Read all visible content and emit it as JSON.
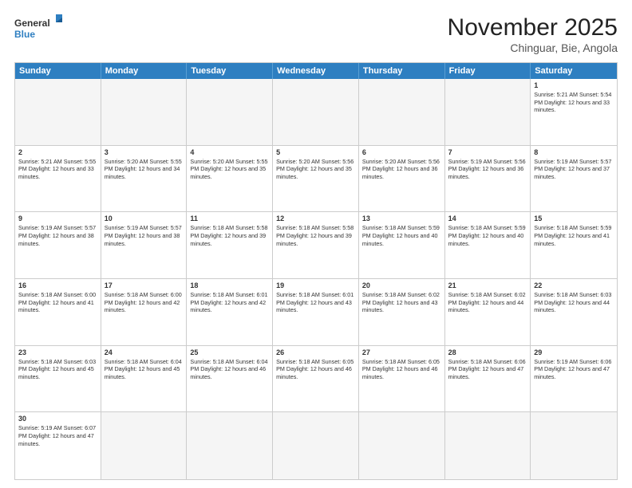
{
  "header": {
    "logo_general": "General",
    "logo_blue": "Blue",
    "month_title": "November 2025",
    "location": "Chinguar, Bie, Angola"
  },
  "weekdays": [
    "Sunday",
    "Monday",
    "Tuesday",
    "Wednesday",
    "Thursday",
    "Friday",
    "Saturday"
  ],
  "rows": [
    [
      {
        "day": "",
        "info": ""
      },
      {
        "day": "",
        "info": ""
      },
      {
        "day": "",
        "info": ""
      },
      {
        "day": "",
        "info": ""
      },
      {
        "day": "",
        "info": ""
      },
      {
        "day": "",
        "info": ""
      },
      {
        "day": "1",
        "info": "Sunrise: 5:21 AM\nSunset: 5:54 PM\nDaylight: 12 hours\nand 33 minutes."
      }
    ],
    [
      {
        "day": "2",
        "info": "Sunrise: 5:21 AM\nSunset: 5:55 PM\nDaylight: 12 hours\nand 33 minutes."
      },
      {
        "day": "3",
        "info": "Sunrise: 5:20 AM\nSunset: 5:55 PM\nDaylight: 12 hours\nand 34 minutes."
      },
      {
        "day": "4",
        "info": "Sunrise: 5:20 AM\nSunset: 5:55 PM\nDaylight: 12 hours\nand 35 minutes."
      },
      {
        "day": "5",
        "info": "Sunrise: 5:20 AM\nSunset: 5:56 PM\nDaylight: 12 hours\nand 35 minutes."
      },
      {
        "day": "6",
        "info": "Sunrise: 5:20 AM\nSunset: 5:56 PM\nDaylight: 12 hours\nand 36 minutes."
      },
      {
        "day": "7",
        "info": "Sunrise: 5:19 AM\nSunset: 5:56 PM\nDaylight: 12 hours\nand 36 minutes."
      },
      {
        "day": "8",
        "info": "Sunrise: 5:19 AM\nSunset: 5:57 PM\nDaylight: 12 hours\nand 37 minutes."
      }
    ],
    [
      {
        "day": "9",
        "info": "Sunrise: 5:19 AM\nSunset: 5:57 PM\nDaylight: 12 hours\nand 38 minutes."
      },
      {
        "day": "10",
        "info": "Sunrise: 5:19 AM\nSunset: 5:57 PM\nDaylight: 12 hours\nand 38 minutes."
      },
      {
        "day": "11",
        "info": "Sunrise: 5:18 AM\nSunset: 5:58 PM\nDaylight: 12 hours\nand 39 minutes."
      },
      {
        "day": "12",
        "info": "Sunrise: 5:18 AM\nSunset: 5:58 PM\nDaylight: 12 hours\nand 39 minutes."
      },
      {
        "day": "13",
        "info": "Sunrise: 5:18 AM\nSunset: 5:59 PM\nDaylight: 12 hours\nand 40 minutes."
      },
      {
        "day": "14",
        "info": "Sunrise: 5:18 AM\nSunset: 5:59 PM\nDaylight: 12 hours\nand 40 minutes."
      },
      {
        "day": "15",
        "info": "Sunrise: 5:18 AM\nSunset: 5:59 PM\nDaylight: 12 hours\nand 41 minutes."
      }
    ],
    [
      {
        "day": "16",
        "info": "Sunrise: 5:18 AM\nSunset: 6:00 PM\nDaylight: 12 hours\nand 41 minutes."
      },
      {
        "day": "17",
        "info": "Sunrise: 5:18 AM\nSunset: 6:00 PM\nDaylight: 12 hours\nand 42 minutes."
      },
      {
        "day": "18",
        "info": "Sunrise: 5:18 AM\nSunset: 6:01 PM\nDaylight: 12 hours\nand 42 minutes."
      },
      {
        "day": "19",
        "info": "Sunrise: 5:18 AM\nSunset: 6:01 PM\nDaylight: 12 hours\nand 43 minutes."
      },
      {
        "day": "20",
        "info": "Sunrise: 5:18 AM\nSunset: 6:02 PM\nDaylight: 12 hours\nand 43 minutes."
      },
      {
        "day": "21",
        "info": "Sunrise: 5:18 AM\nSunset: 6:02 PM\nDaylight: 12 hours\nand 44 minutes."
      },
      {
        "day": "22",
        "info": "Sunrise: 5:18 AM\nSunset: 6:03 PM\nDaylight: 12 hours\nand 44 minutes."
      }
    ],
    [
      {
        "day": "23",
        "info": "Sunrise: 5:18 AM\nSunset: 6:03 PM\nDaylight: 12 hours\nand 45 minutes."
      },
      {
        "day": "24",
        "info": "Sunrise: 5:18 AM\nSunset: 6:04 PM\nDaylight: 12 hours\nand 45 minutes."
      },
      {
        "day": "25",
        "info": "Sunrise: 5:18 AM\nSunset: 6:04 PM\nDaylight: 12 hours\nand 46 minutes."
      },
      {
        "day": "26",
        "info": "Sunrise: 5:18 AM\nSunset: 6:05 PM\nDaylight: 12 hours\nand 46 minutes."
      },
      {
        "day": "27",
        "info": "Sunrise: 5:18 AM\nSunset: 6:05 PM\nDaylight: 12 hours\nand 46 minutes."
      },
      {
        "day": "28",
        "info": "Sunrise: 5:18 AM\nSunset: 6:06 PM\nDaylight: 12 hours\nand 47 minutes."
      },
      {
        "day": "29",
        "info": "Sunrise: 5:19 AM\nSunset: 6:06 PM\nDaylight: 12 hours\nand 47 minutes."
      }
    ],
    [
      {
        "day": "30",
        "info": "Sunrise: 5:19 AM\nSunset: 6:07 PM\nDaylight: 12 hours\nand 47 minutes."
      },
      {
        "day": "",
        "info": ""
      },
      {
        "day": "",
        "info": ""
      },
      {
        "day": "",
        "info": ""
      },
      {
        "day": "",
        "info": ""
      },
      {
        "day": "",
        "info": ""
      },
      {
        "day": "",
        "info": ""
      }
    ]
  ]
}
